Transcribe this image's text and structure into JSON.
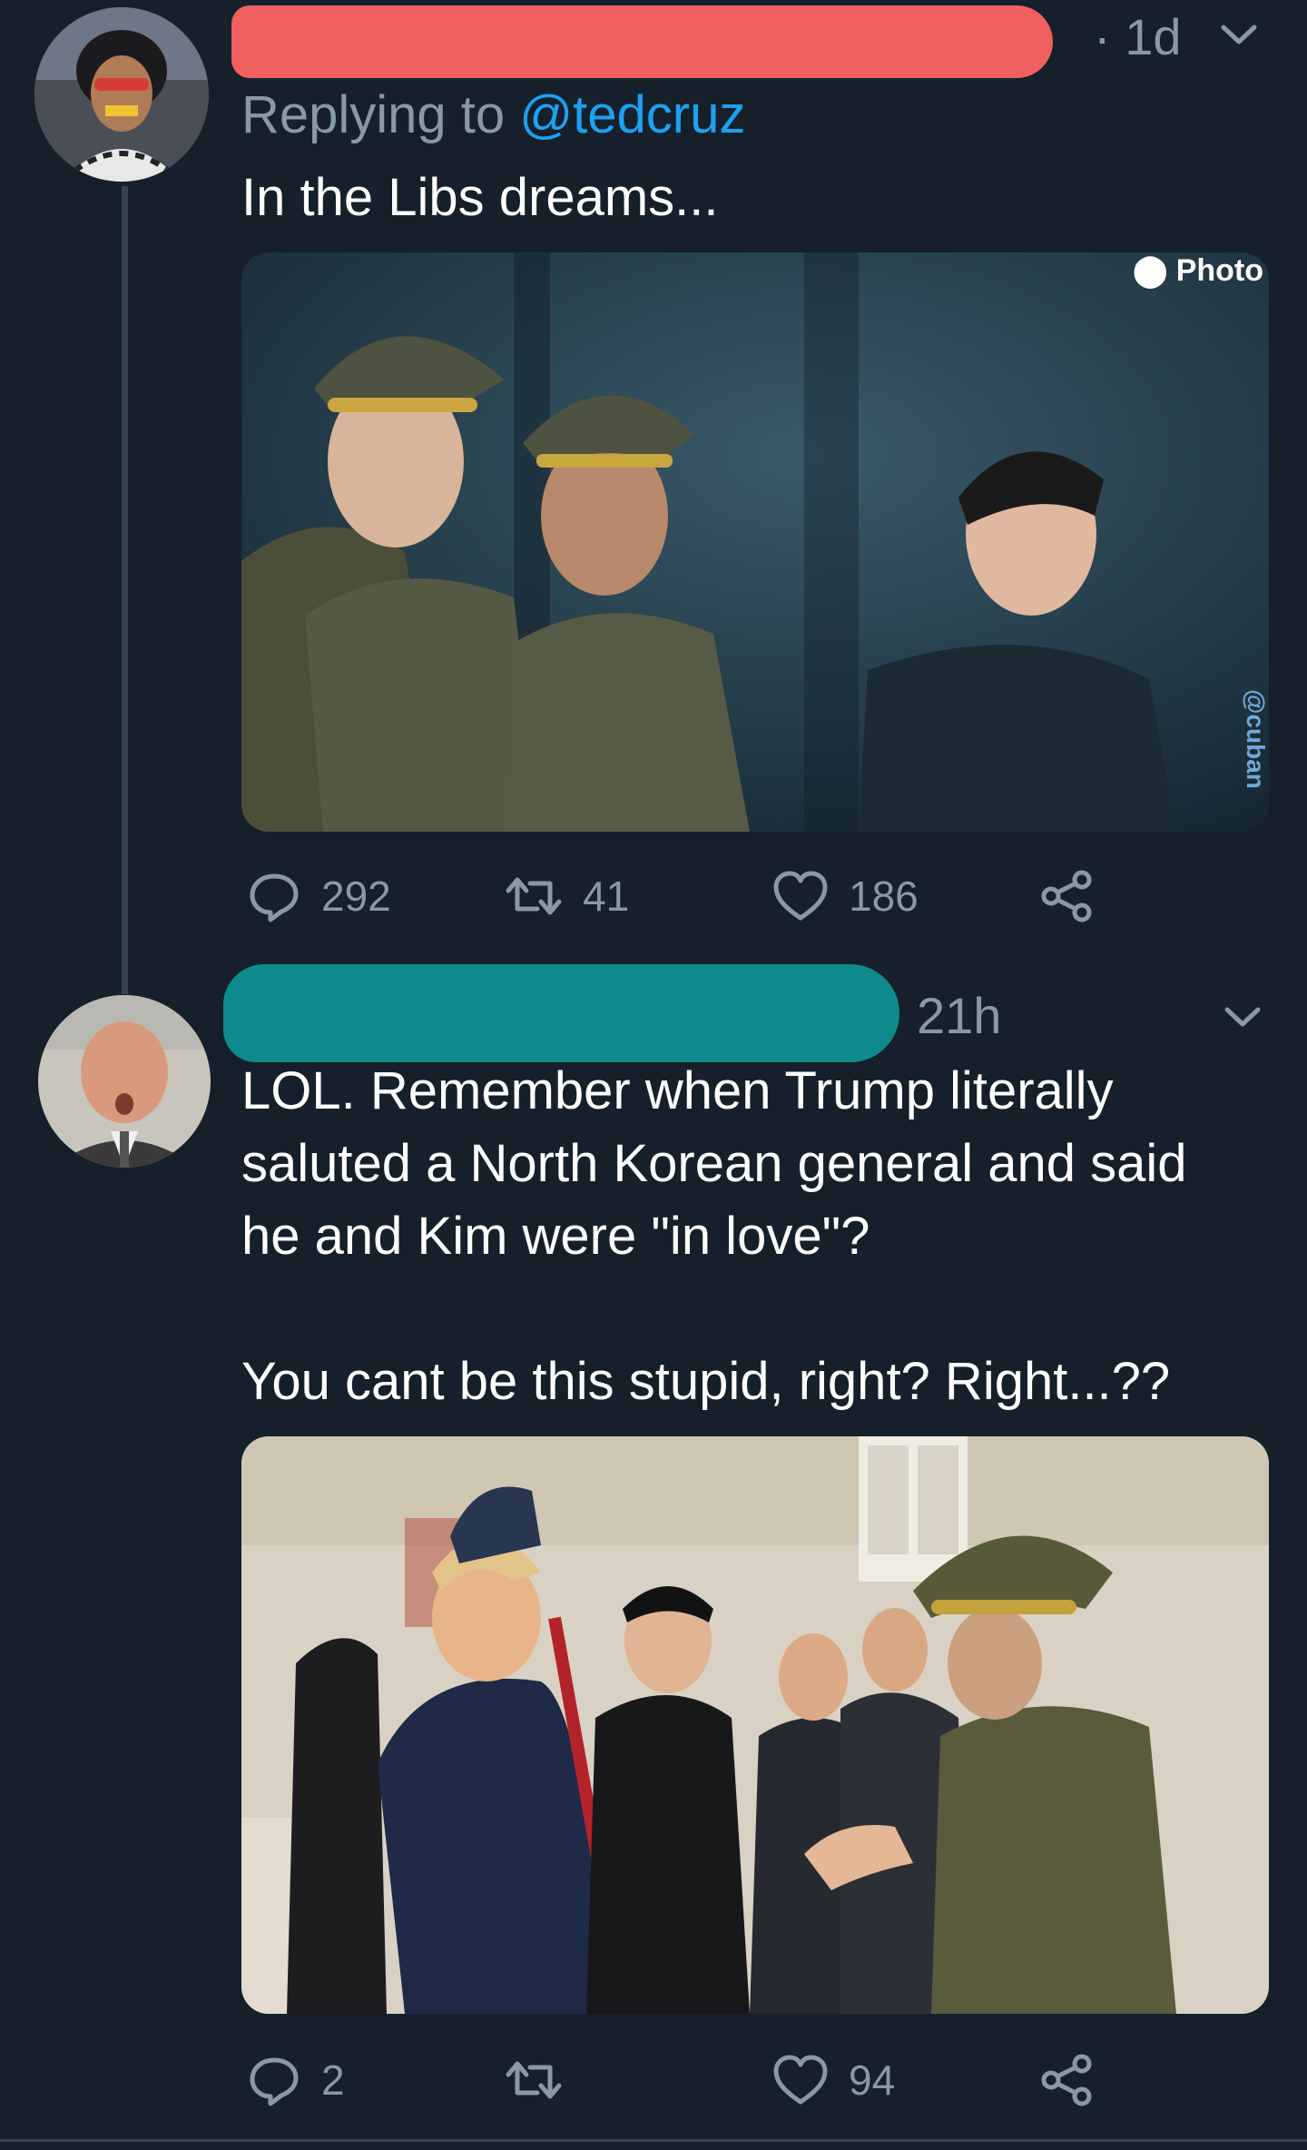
{
  "tweet1": {
    "time": "· 1d",
    "replying_prefix": "Replying to ",
    "replying_handle": "@tedcruz",
    "text": "In the Libs dreams...",
    "image_watermark_top": "Photo",
    "image_watermark_side": "@cuban",
    "stats": {
      "replies": "292",
      "retweets": "41",
      "likes": "186"
    },
    "colors": {
      "redaction": "#f06061"
    }
  },
  "tweet2": {
    "time": "21h",
    "text_line1": "LOL. Remember when Trump literally",
    "text_line2": "saluted a North Korean general and said",
    "text_line3": "he and Kim were \"in love\"?",
    "text_line4": "You cant be this stupid, right? Right...??",
    "stats": {
      "replies": "2",
      "retweets": "",
      "likes": "94"
    },
    "colors": {
      "redaction": "#0f8a8c"
    }
  },
  "icons": [
    "reply-icon",
    "retweet-icon",
    "like-icon",
    "share-icon",
    "chevron-down-icon"
  ],
  "theme": {
    "background": "#15202b",
    "secondary_text": "#8899a6",
    "link": "#1da1f2"
  }
}
